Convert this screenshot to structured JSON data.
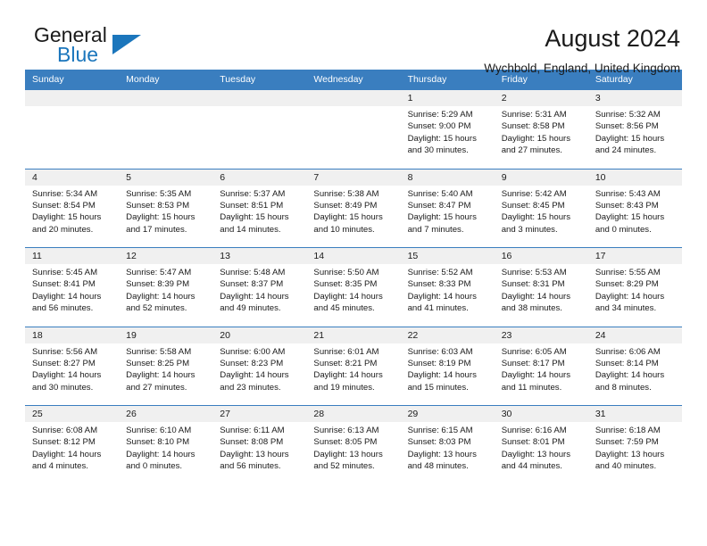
{
  "brand": {
    "line1": "General",
    "line2": "Blue",
    "accent_color": "#1b76bc",
    "logo_icon": "triangle-icon"
  },
  "header": {
    "title": "August 2024",
    "subtitle": "Wychbold, England, United Kingdom",
    "header_bg_color": "#3a7ebf"
  },
  "calendar": {
    "weekdays": [
      "Sunday",
      "Monday",
      "Tuesday",
      "Wednesday",
      "Thursday",
      "Friday",
      "Saturday"
    ],
    "weeks": [
      [
        {
          "day": "",
          "details": ""
        },
        {
          "day": "",
          "details": ""
        },
        {
          "day": "",
          "details": ""
        },
        {
          "day": "",
          "details": ""
        },
        {
          "day": "1",
          "details": "Sunrise: 5:29 AM\nSunset: 9:00 PM\nDaylight: 15 hours\nand 30 minutes."
        },
        {
          "day": "2",
          "details": "Sunrise: 5:31 AM\nSunset: 8:58 PM\nDaylight: 15 hours\nand 27 minutes."
        },
        {
          "day": "3",
          "details": "Sunrise: 5:32 AM\nSunset: 8:56 PM\nDaylight: 15 hours\nand 24 minutes."
        }
      ],
      [
        {
          "day": "4",
          "details": "Sunrise: 5:34 AM\nSunset: 8:54 PM\nDaylight: 15 hours\nand 20 minutes."
        },
        {
          "day": "5",
          "details": "Sunrise: 5:35 AM\nSunset: 8:53 PM\nDaylight: 15 hours\nand 17 minutes."
        },
        {
          "day": "6",
          "details": "Sunrise: 5:37 AM\nSunset: 8:51 PM\nDaylight: 15 hours\nand 14 minutes."
        },
        {
          "day": "7",
          "details": "Sunrise: 5:38 AM\nSunset: 8:49 PM\nDaylight: 15 hours\nand 10 minutes."
        },
        {
          "day": "8",
          "details": "Sunrise: 5:40 AM\nSunset: 8:47 PM\nDaylight: 15 hours\nand 7 minutes."
        },
        {
          "day": "9",
          "details": "Sunrise: 5:42 AM\nSunset: 8:45 PM\nDaylight: 15 hours\nand 3 minutes."
        },
        {
          "day": "10",
          "details": "Sunrise: 5:43 AM\nSunset: 8:43 PM\nDaylight: 15 hours\nand 0 minutes."
        }
      ],
      [
        {
          "day": "11",
          "details": "Sunrise: 5:45 AM\nSunset: 8:41 PM\nDaylight: 14 hours\nand 56 minutes."
        },
        {
          "day": "12",
          "details": "Sunrise: 5:47 AM\nSunset: 8:39 PM\nDaylight: 14 hours\nand 52 minutes."
        },
        {
          "day": "13",
          "details": "Sunrise: 5:48 AM\nSunset: 8:37 PM\nDaylight: 14 hours\nand 49 minutes."
        },
        {
          "day": "14",
          "details": "Sunrise: 5:50 AM\nSunset: 8:35 PM\nDaylight: 14 hours\nand 45 minutes."
        },
        {
          "day": "15",
          "details": "Sunrise: 5:52 AM\nSunset: 8:33 PM\nDaylight: 14 hours\nand 41 minutes."
        },
        {
          "day": "16",
          "details": "Sunrise: 5:53 AM\nSunset: 8:31 PM\nDaylight: 14 hours\nand 38 minutes."
        },
        {
          "day": "17",
          "details": "Sunrise: 5:55 AM\nSunset: 8:29 PM\nDaylight: 14 hours\nand 34 minutes."
        }
      ],
      [
        {
          "day": "18",
          "details": "Sunrise: 5:56 AM\nSunset: 8:27 PM\nDaylight: 14 hours\nand 30 minutes."
        },
        {
          "day": "19",
          "details": "Sunrise: 5:58 AM\nSunset: 8:25 PM\nDaylight: 14 hours\nand 27 minutes."
        },
        {
          "day": "20",
          "details": "Sunrise: 6:00 AM\nSunset: 8:23 PM\nDaylight: 14 hours\nand 23 minutes."
        },
        {
          "day": "21",
          "details": "Sunrise: 6:01 AM\nSunset: 8:21 PM\nDaylight: 14 hours\nand 19 minutes."
        },
        {
          "day": "22",
          "details": "Sunrise: 6:03 AM\nSunset: 8:19 PM\nDaylight: 14 hours\nand 15 minutes."
        },
        {
          "day": "23",
          "details": "Sunrise: 6:05 AM\nSunset: 8:17 PM\nDaylight: 14 hours\nand 11 minutes."
        },
        {
          "day": "24",
          "details": "Sunrise: 6:06 AM\nSunset: 8:14 PM\nDaylight: 14 hours\nand 8 minutes."
        }
      ],
      [
        {
          "day": "25",
          "details": "Sunrise: 6:08 AM\nSunset: 8:12 PM\nDaylight: 14 hours\nand 4 minutes."
        },
        {
          "day": "26",
          "details": "Sunrise: 6:10 AM\nSunset: 8:10 PM\nDaylight: 14 hours\nand 0 minutes."
        },
        {
          "day": "27",
          "details": "Sunrise: 6:11 AM\nSunset: 8:08 PM\nDaylight: 13 hours\nand 56 minutes."
        },
        {
          "day": "28",
          "details": "Sunrise: 6:13 AM\nSunset: 8:05 PM\nDaylight: 13 hours\nand 52 minutes."
        },
        {
          "day": "29",
          "details": "Sunrise: 6:15 AM\nSunset: 8:03 PM\nDaylight: 13 hours\nand 48 minutes."
        },
        {
          "day": "30",
          "details": "Sunrise: 6:16 AM\nSunset: 8:01 PM\nDaylight: 13 hours\nand 44 minutes."
        },
        {
          "day": "31",
          "details": "Sunrise: 6:18 AM\nSunset: 7:59 PM\nDaylight: 13 hours\nand 40 minutes."
        }
      ]
    ]
  }
}
